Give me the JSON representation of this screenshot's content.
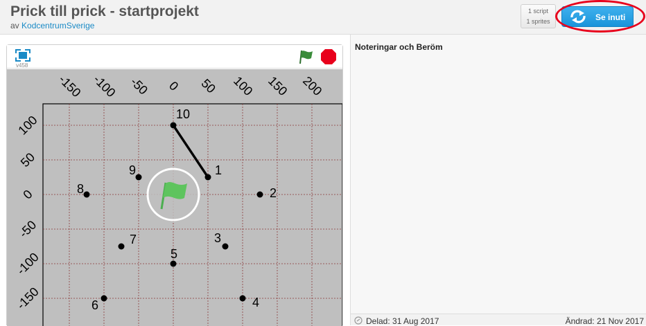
{
  "project": {
    "title": "Prick till prick - startprojekt",
    "by_prefix": "av",
    "author": "KodcentrumSverige"
  },
  "stats": {
    "scripts": "1 script",
    "sprites": "1 sprites"
  },
  "see_inside": {
    "label": "Se inuti",
    "icon": "remix-arrows-icon"
  },
  "player": {
    "version": "v458",
    "fullscreen_icon": "fullscreen-icon",
    "green_flag_icon": "green-flag-icon",
    "stop_icon": "stop-sign-icon"
  },
  "stage": {
    "x_ticks": [
      "-150",
      "-100",
      "-50",
      "0",
      "50",
      "100",
      "150",
      "200"
    ],
    "y_ticks": [
      "100",
      "50",
      "0",
      "-50",
      "-100",
      "-150"
    ],
    "points": [
      {
        "label": "1",
        "x": 50,
        "y": 25
      },
      {
        "label": "2",
        "x": 125,
        "y": 0
      },
      {
        "label": "3",
        "x": 75,
        "y": -75
      },
      {
        "label": "4",
        "x": 100,
        "y": -150
      },
      {
        "label": "5",
        "x": 0,
        "y": -100
      },
      {
        "label": "6",
        "x": -100,
        "y": -150
      },
      {
        "label": "7",
        "x": -75,
        "y": -75
      },
      {
        "label": "8",
        "x": -125,
        "y": 0
      },
      {
        "label": "9",
        "x": -50,
        "y": 25
      },
      {
        "label": "10",
        "x": 0,
        "y": 100
      }
    ],
    "line": {
      "from": "10",
      "to": "1"
    }
  },
  "notes": {
    "title": "Noteringar och Beröm"
  },
  "dates": {
    "shared": "Delad: 31 Aug 2017",
    "changed": "Ändrad: 21 Nov 2017"
  },
  "colors": {
    "accent": "#1a94da",
    "highlight": "#e8001c",
    "stage_bg": "#bfbfbf",
    "grid": "#8b3a3a"
  }
}
